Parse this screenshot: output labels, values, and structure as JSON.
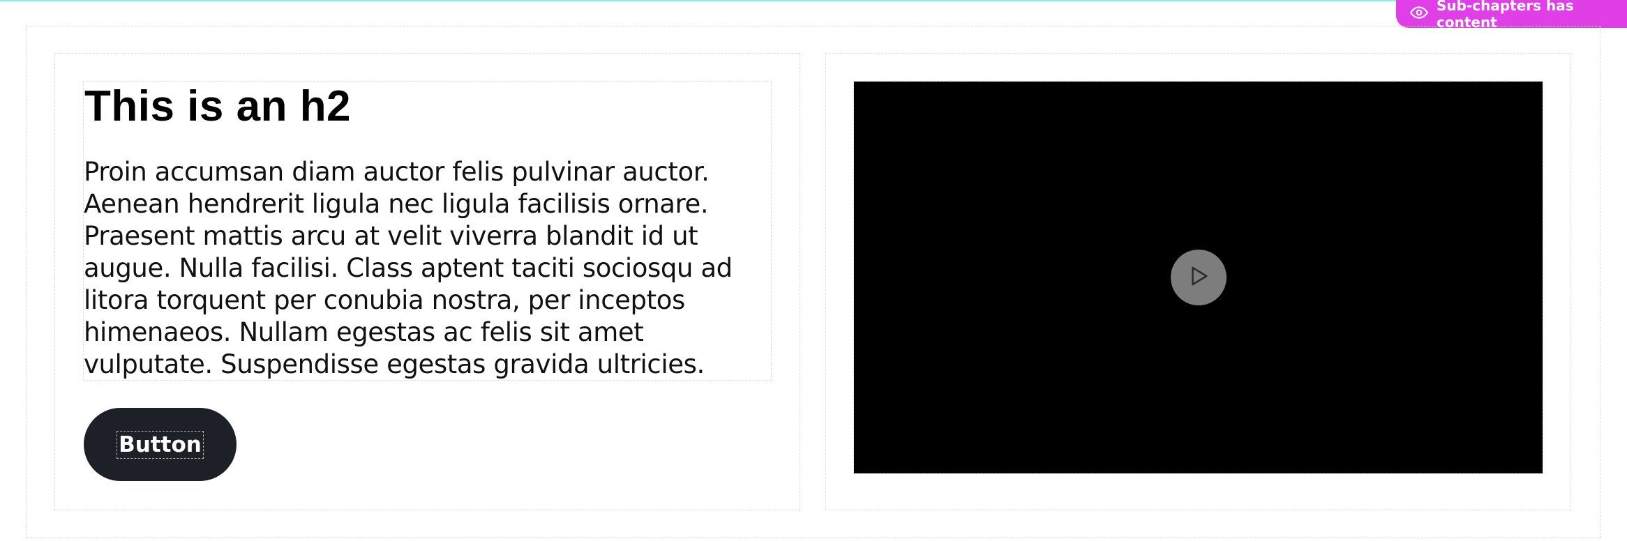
{
  "badge": {
    "icon": "eye-icon",
    "label": "Sub-chapters has content",
    "color": "#e03ee6"
  },
  "text_block": {
    "heading": "This is an h2",
    "paragraph": "Proin accumsan diam auctor felis pulvinar auctor. Aenean hendrerit ligula nec ligula facilisis ornare. Praesent mattis arcu at velit viverra blandit id ut augue. Nulla facilisi. Class aptent taciti sociosqu ad litora torquent per conubia nostra, per inceptos himenaeos. Nullam egestas ac felis sit amet vulputate. Suspendisse egestas gravida ultricies.",
    "button_label": "Button"
  },
  "video": {
    "play_icon": "play-icon",
    "background": "#000000"
  },
  "colors": {
    "accent": "#e03ee6",
    "button_bg": "#1d2027",
    "top_line": "#7ff0f0"
  }
}
